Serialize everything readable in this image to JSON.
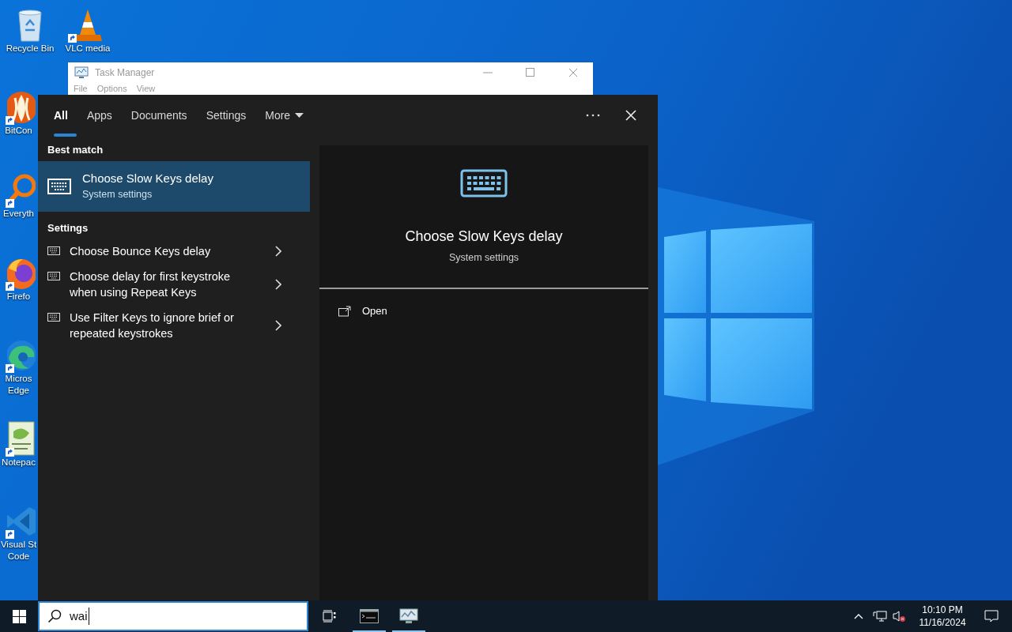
{
  "desktop": {
    "icons": [
      {
        "kind": "bin",
        "label": "Recycle Bin",
        "shortcut": false
      },
      {
        "kind": "cone",
        "label": "VLC media",
        "shortcut": true
      },
      {
        "kind": "comet",
        "label": "BitCon",
        "shortcut": true
      },
      {
        "kind": "magnifier",
        "label": "Everyth",
        "shortcut": true
      },
      {
        "kind": "firefox",
        "label": "Firefo",
        "shortcut": true
      },
      {
        "kind": "edge",
        "label": "Micros Edge",
        "shortcut": true
      },
      {
        "kind": "notepad",
        "label": "Notepac",
        "shortcut": true
      },
      {
        "kind": "vscode",
        "label": "Visual St Code",
        "shortcut": true
      }
    ]
  },
  "task_manager": {
    "title": "Task Manager",
    "menu": [
      "File",
      "Options",
      "View"
    ]
  },
  "search": {
    "tabs": [
      {
        "label": "All",
        "selected": true,
        "kind": "tab"
      },
      {
        "label": "Apps",
        "selected": false,
        "kind": "tab"
      },
      {
        "label": "Documents",
        "selected": false,
        "kind": "tab"
      },
      {
        "label": "Settings",
        "selected": false,
        "kind": "tab"
      },
      {
        "label": "More",
        "selected": false,
        "kind": "dropdown"
      }
    ],
    "best_match": {
      "heading": "Best match",
      "title": "Choose Slow Keys delay",
      "subtitle": "System settings",
      "selected": true
    },
    "section": {
      "heading": "Settings",
      "results": [
        {
          "text": "Choose Bounce Keys delay"
        },
        {
          "text": "Choose delay for first keystroke when using Repeat Keys"
        },
        {
          "text": "Use Filter Keys to ignore brief or repeated keystrokes"
        }
      ]
    },
    "detail": {
      "title": "Choose Slow Keys delay",
      "subtitle": "System settings",
      "actions": [
        {
          "label": "Open"
        }
      ]
    },
    "query": "wai"
  },
  "taskbar": {
    "apps": [
      {
        "kind": "taskview",
        "running": false
      },
      {
        "kind": "terminal",
        "running": true
      },
      {
        "kind": "taskmgr",
        "running": true
      }
    ],
    "tray": {
      "muted": true,
      "time": "10:10 PM",
      "date": "11/16/2024"
    }
  }
}
